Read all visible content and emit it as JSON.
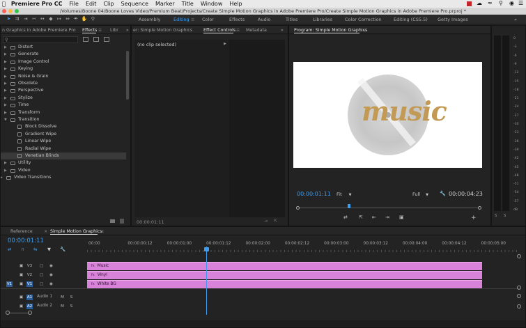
{
  "menubar": {
    "app": "Premiere Pro CC",
    "items": [
      "File",
      "Edit",
      "Clip",
      "Sequence",
      "Marker",
      "Title",
      "Window",
      "Help"
    ]
  },
  "titlebar": {
    "path": "/Volumes/Boone 04/Boone Loves Video/Premium Beat/Projects/Create Simple Motion Graphics in Adobe Premiere Pro/Create Simple Motion Graphics in Adobe Premiere Pro.prproj *"
  },
  "workspaces": [
    "Assembly",
    "Editing",
    "Color",
    "Effects",
    "Audio",
    "Titles",
    "Libraries",
    "Color Correction",
    "Editing (CS5.5)",
    "Getty Images"
  ],
  "workspace_active": "Editing",
  "project_panel": {
    "tab_project": "n Graphics in Adobe Premiere Pro",
    "tab_effects": "Effects",
    "tab_libraries": "Libr",
    "search_placeholder": ""
  },
  "effects": [
    {
      "name": "Distort",
      "level": 0,
      "open": false
    },
    {
      "name": "Generate",
      "level": 0,
      "open": false
    },
    {
      "name": "Image Control",
      "level": 0,
      "open": false
    },
    {
      "name": "Keying",
      "level": 0,
      "open": false
    },
    {
      "name": "Noise & Grain",
      "level": 0,
      "open": false
    },
    {
      "name": "Obsolete",
      "level": 0,
      "open": false
    },
    {
      "name": "Perspective",
      "level": 0,
      "open": false
    },
    {
      "name": "Stylize",
      "level": 0,
      "open": false
    },
    {
      "name": "Time",
      "level": 0,
      "open": false
    },
    {
      "name": "Transform",
      "level": 0,
      "open": false
    },
    {
      "name": "Transition",
      "level": 0,
      "open": true
    },
    {
      "name": "Block Dissolve",
      "level": 1
    },
    {
      "name": "Gradient Wipe",
      "level": 1
    },
    {
      "name": "Linear Wipe",
      "level": 1
    },
    {
      "name": "Radial Wipe",
      "level": 1
    },
    {
      "name": "Venetian Blinds",
      "level": 1,
      "selected": true
    },
    {
      "name": "Utility",
      "level": 0,
      "open": false
    },
    {
      "name": "Video",
      "level": 0,
      "open": false
    },
    {
      "name": "Video Transitions",
      "level": -1,
      "open": false
    }
  ],
  "effect_controls": {
    "tab_source": "er: Simple Motion Graphics",
    "tab_effect_controls": "Effect Controls",
    "tab_metadata": "Metadata",
    "clip_label": "(no clip selected)",
    "timecode": "00:00:01:11"
  },
  "program": {
    "title": "Program: Simple Motion Graphics",
    "graphic_text": "music",
    "timecode": "00:00:01:11",
    "fit": "Fit",
    "quality": "Full",
    "duration": "00:00:04:23",
    "playhead_fraction": 0.28
  },
  "meter": {
    "labels": [
      "0",
      "-3",
      "-6",
      "-9",
      "-12",
      "-15",
      "-18",
      "-21",
      "-24",
      "-27",
      "-30",
      "-33",
      "-36",
      "-39",
      "-42",
      "-45",
      "-48",
      "-51",
      "-54",
      "-57",
      "dB"
    ],
    "bottom": [
      "S",
      "S"
    ]
  },
  "timeline": {
    "tab_reference": "Reference",
    "tab_sequence": "Simple Motion Graphics",
    "timecode": "00:00:01:11",
    "ruler": [
      "00:00",
      "00:00:00:12",
      "00:00:01:00",
      "00:00:01:12",
      "00:00:02:00",
      "00:00:02:12",
      "00:00:03:00",
      "00:00:03:12",
      "00:00:04:00",
      "00:00:04:12",
      "00:00:05:00"
    ],
    "video_tracks": [
      {
        "id": "V3",
        "clip": "Music"
      },
      {
        "id": "V2",
        "clip": "Vinyl"
      },
      {
        "id": "V1",
        "clip": "White BG",
        "source": "V1"
      }
    ],
    "audio_tracks": [
      {
        "id": "A1",
        "name": "Audio 1",
        "source": "A1"
      },
      {
        "id": "A2",
        "name": "Audio 2",
        "source": "A2"
      }
    ],
    "playhead_fraction": 0.2766
  },
  "colors": {
    "accent": "#3d9cf0",
    "clip": "#d982d9",
    "timecode": "#3d9cf0"
  }
}
